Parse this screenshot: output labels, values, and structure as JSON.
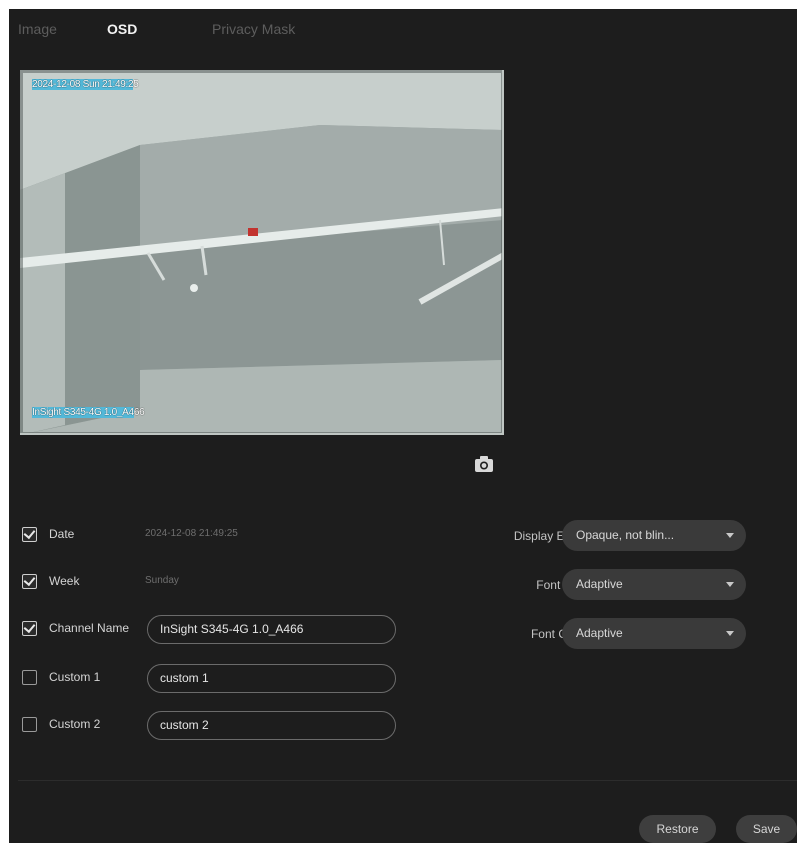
{
  "tabs": [
    {
      "label": "Image"
    },
    {
      "label": "OSD"
    },
    {
      "label": "Privacy Mask"
    }
  ],
  "active_tab": "OSD",
  "preview": {
    "osd_date_highlight": "2024-12-08 Sun 21:49:2",
    "osd_date_tail": "5",
    "osd_channel_highlight": "InSight S345-4G 1.0_A4",
    "osd_channel_tail": "66"
  },
  "fields": {
    "date": {
      "label": "Date",
      "checked": true,
      "value": "2024-12-08 21:49:25"
    },
    "week": {
      "label": "Week",
      "checked": true,
      "value": "Sunday"
    },
    "channel_name": {
      "label": "Channel Name",
      "checked": true,
      "value": "InSight S345-4G 1.0_A466"
    },
    "custom1": {
      "label": "Custom 1",
      "checked": false,
      "value": "custom 1"
    },
    "custom2": {
      "label": "Custom 2",
      "checked": false,
      "value": "custom 2"
    }
  },
  "settings": {
    "display_effect": {
      "label": "Display Effect",
      "value": "Opaque, not blin..."
    },
    "font_size": {
      "label": "Font Size",
      "value": "Adaptive"
    },
    "font_color": {
      "label": "Font Color",
      "value": "Adaptive"
    }
  },
  "actions": {
    "restore": "Restore",
    "save": "Save"
  },
  "icons": {
    "snapshot": "camera-icon",
    "dropdown": "chevron-down-icon",
    "checkbox": "check-icon"
  },
  "colors": {
    "background": "#1d1d1d",
    "osd_highlight": "#53b8d8"
  }
}
